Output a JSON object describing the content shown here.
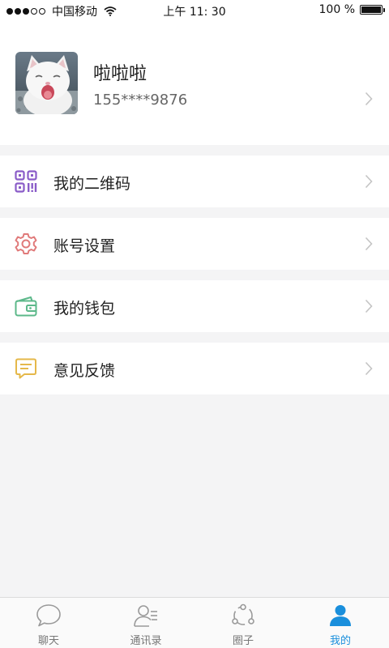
{
  "status_bar": {
    "carrier": "中国移动",
    "time": "上午 11: 30",
    "battery": "100 %"
  },
  "profile": {
    "name": "啦啦啦",
    "phone": "155****9876"
  },
  "menu": {
    "items": [
      {
        "label": "我的二维码",
        "icon": "qr-code-icon",
        "color": "#8a5cc8"
      },
      {
        "label": "账号设置",
        "icon": "gear-icon",
        "color": "#e07a7a"
      },
      {
        "label": "我的钱包",
        "icon": "wallet-icon",
        "color": "#5cb88a"
      },
      {
        "label": "意见反馈",
        "icon": "feedback-icon",
        "color": "#e5b84a"
      }
    ]
  },
  "tabs": [
    {
      "label": "聊天",
      "icon": "chat-bubble-icon"
    },
    {
      "label": "通讯录",
      "icon": "contacts-icon"
    },
    {
      "label": "圈子",
      "icon": "circle-share-icon"
    },
    {
      "label": "我的",
      "icon": "person-icon",
      "active": true
    }
  ],
  "colors": {
    "accent": "#1a8fdc",
    "background": "#f4f4f5"
  }
}
